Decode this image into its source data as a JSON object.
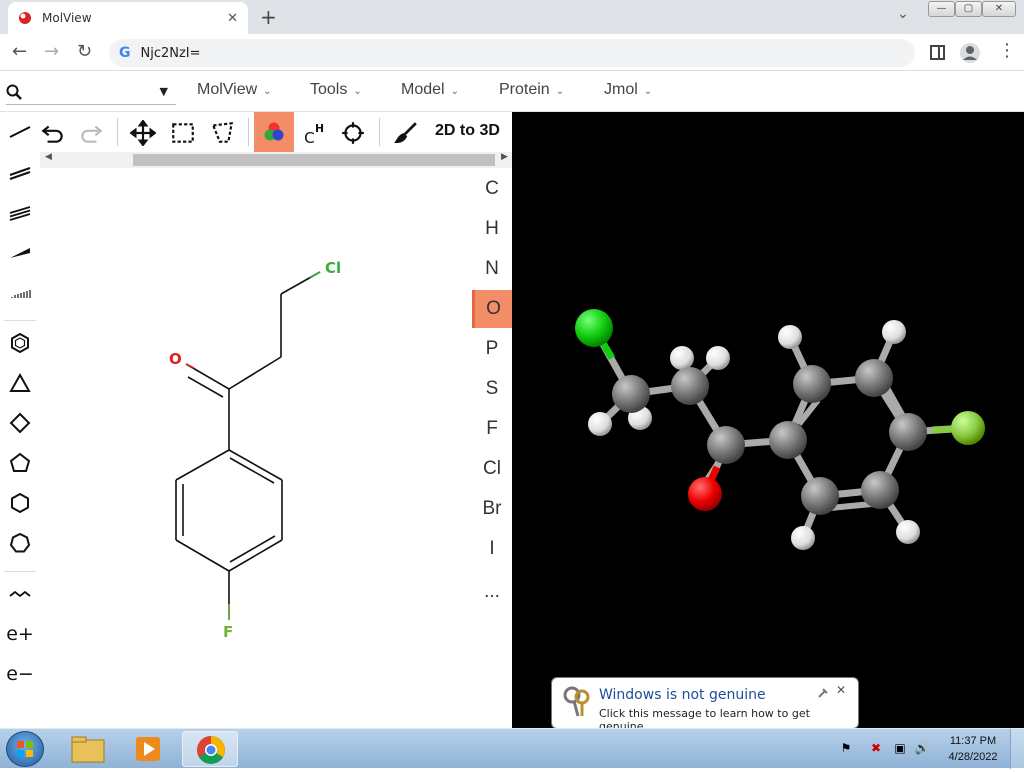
{
  "browser": {
    "tab_title": "MolView",
    "tab_close": "✕",
    "new_tab": "+",
    "tab_search": "⌄",
    "url": "Njc2NzI=",
    "window_controls": [
      "—",
      "▢",
      "✕"
    ]
  },
  "menubar": {
    "search_placeholder": "",
    "items": [
      {
        "label": "MolView"
      },
      {
        "label": "Tools"
      },
      {
        "label": "Model"
      },
      {
        "label": "Protein"
      },
      {
        "label": "Jmol"
      }
    ]
  },
  "editor": {
    "convert_label": "2D to 3D",
    "elements": [
      "C",
      "H",
      "N",
      "O",
      "P",
      "S",
      "F",
      "Cl",
      "Br",
      "I",
      "..."
    ],
    "active_element": "O",
    "left_tools": [
      "single-bond",
      "double-bond",
      "triple-bond",
      "wedge-bond",
      "hash-bond",
      "benzene",
      "triangle",
      "square",
      "pentagon",
      "hexagon",
      "heptagon",
      "chain",
      "charge-plus",
      "charge-minus"
    ],
    "charge_plus": "e+",
    "charge_minus": "e−",
    "atom_labels": {
      "cl": "Cl",
      "o": "O",
      "f": "F"
    },
    "colors": {
      "cl": "#38b038",
      "o": "#e02020",
      "f": "#78b040",
      "accent": "#f28d67"
    }
  },
  "notification": {
    "title": "Windows is not genuine",
    "message": "Click this message to learn how to get genuine."
  },
  "taskbar": {
    "time": "11:37 PM",
    "date": "4/28/2022"
  }
}
